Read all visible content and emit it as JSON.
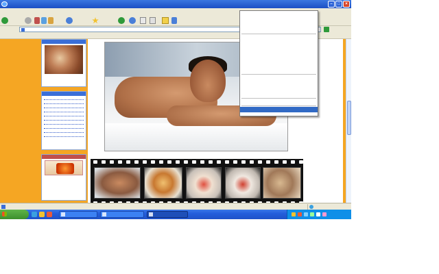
{
  "window": {
    "title": "",
    "minimize_label": "–",
    "maximize_label": "□",
    "close_label": "×"
  },
  "menubar": {
    "items": [
      "",
      "",
      "",
      "",
      "",
      ""
    ]
  },
  "toolbar": {
    "back_label": "",
    "search_label": "",
    "favorites_label": "",
    "go_label": ""
  },
  "addressbar": {
    "label": "",
    "url": "",
    "go_label": ""
  },
  "linksbar": {
    "label": "",
    "links_label": ""
  },
  "sidebar": {
    "recipe_box_title": "",
    "recipe_box_footer": "",
    "links_box_title": "",
    "links_box_footer": "",
    "birthday_box_title": "",
    "birthday_text": "",
    "birthday_footer": "",
    "birthday_image_text": ""
  },
  "context_menu": {
    "items": [
      {
        "label": "",
        "disabled": false
      },
      {
        "label": "",
        "disabled": false
      },
      {
        "label": "",
        "disabled": false
      },
      {
        "label": "",
        "disabled": false
      },
      {
        "sep": true
      },
      {
        "label": "",
        "disabled": true
      },
      {
        "label": "",
        "disabled": false
      },
      {
        "label": "",
        "disabled": false
      },
      {
        "label": "",
        "disabled": false
      },
      {
        "label": "",
        "disabled": false
      },
      {
        "label": "",
        "disabled": false
      },
      {
        "label": "",
        "disabled": false
      },
      {
        "sep": true
      },
      {
        "label": "",
        "disabled": true
      },
      {
        "label": "",
        "disabled": false
      },
      {
        "label": "",
        "disabled": false
      },
      {
        "label": "",
        "disabled": true
      },
      {
        "sep": true
      },
      {
        "label": "",
        "disabled": false
      },
      {
        "sep": true
      },
      {
        "label": "",
        "disabled": false,
        "selected": true
      }
    ]
  },
  "statusbar": {
    "text": "",
    "zone": ""
  },
  "taskbar": {
    "start_label": "",
    "tasks": [
      {
        "label": "",
        "active": false
      },
      {
        "label": "",
        "active": false
      },
      {
        "label": "",
        "active": true
      }
    ],
    "clock": ""
  },
  "colors": {
    "page_background": "#f5a623",
    "menu_highlight": "#316ac5",
    "taskbar": "#245edb",
    "start_button": "#3c8f2c"
  }
}
